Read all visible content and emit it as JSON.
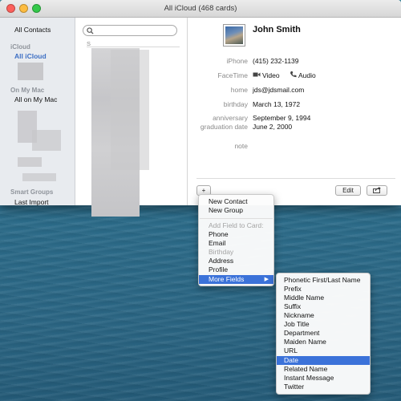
{
  "window": {
    "title": "All iCloud (468 cards)",
    "colors": {
      "close": "#fc605b",
      "minimize": "#fdbc40",
      "zoom": "#34c84a"
    }
  },
  "groups": {
    "all_contacts": "All Contacts",
    "icloud_header": "iCloud",
    "all_icloud": "All iCloud",
    "on_my_mac_header": "On My Mac",
    "all_on_my_mac": "All on My Mac",
    "smart_groups_header": "Smart Groups",
    "last_import": "Last Import"
  },
  "cardlist": {
    "search_placeholder": "",
    "section_letter": "S"
  },
  "contact": {
    "name": "John Smith",
    "fields": [
      {
        "label": "iPhone",
        "value": "(415) 232-1139"
      },
      {
        "label": "FaceTime",
        "video": "Video",
        "audio": "Audio"
      },
      {
        "label": "home",
        "value": "jds@jdsmail.com"
      },
      {
        "label": "birthday",
        "value": "March 13, 1972"
      },
      {
        "label": "anniversary",
        "value": "September 9, 1994"
      },
      {
        "label": "graduation date",
        "value": "June 2, 2000"
      },
      {
        "label": "note",
        "value": ""
      }
    ]
  },
  "toolbar": {
    "add_label": "+",
    "edit_label": "Edit",
    "share_icon": "share-icon"
  },
  "add_menu": {
    "items": [
      "New Contact",
      "New Group"
    ],
    "add_field_header": "Add Field to Card:",
    "fields": [
      "Phone",
      "Email",
      "Birthday",
      "Address",
      "Profile"
    ],
    "disabled": [
      "Birthday"
    ],
    "more_fields": "More Fields"
  },
  "more_fields_menu": {
    "items": [
      "Phonetic First/Last Name",
      "Prefix",
      "Middle Name",
      "Suffix",
      "Nickname",
      "Job Title",
      "Department",
      "Maiden Name",
      "URL",
      "Date",
      "Related Name",
      "Instant Message",
      "Twitter"
    ],
    "highlighted": "Date",
    "highlight_color": "#3b72d9"
  }
}
